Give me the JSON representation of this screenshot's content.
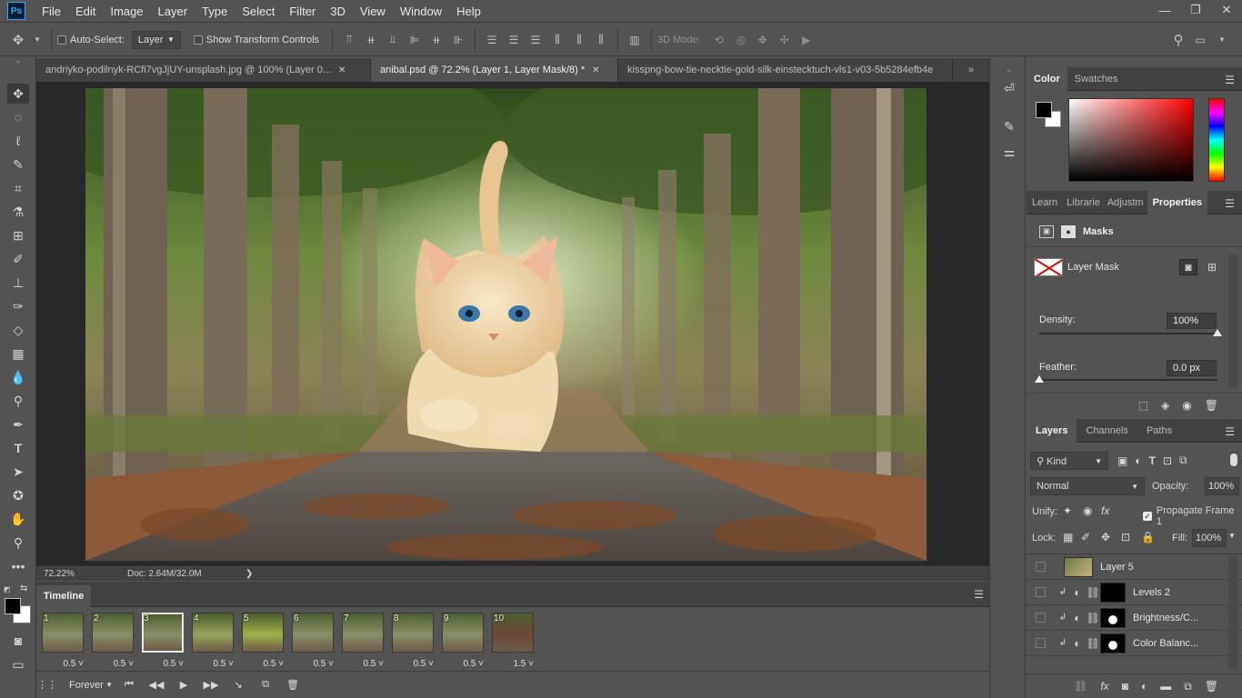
{
  "app": {
    "logo": "Ps"
  },
  "menu": [
    "File",
    "Edit",
    "Image",
    "Layer",
    "Type",
    "Select",
    "Filter",
    "3D",
    "View",
    "Window",
    "Help"
  ],
  "window_controls": {
    "minimize": "—",
    "restore": "❐",
    "close": "✕"
  },
  "options": {
    "auto_select_label": "Auto-Select:",
    "auto_select_target": "Layer",
    "show_transform_label": "Show Transform Controls",
    "mode_3d_label": "3D Mode:"
  },
  "tabs": [
    {
      "label": "andriyko-podilnyk-RCfi7vgJjUY-unsplash.jpg @ 100% (Layer 0...",
      "active": false
    },
    {
      "label": "anibal.psd @ 72.2% (Layer 1, Layer Mask/8) *",
      "active": true
    },
    {
      "label": "kisspng-bow-tie-necktie-gold-silk-einstecktuch-vls1-v03-5b5284efb4e",
      "active": false
    }
  ],
  "status": {
    "zoom": "72.22%",
    "doc": "Doc: 2.64M/32.0M",
    "arrow": "❯"
  },
  "timeline": {
    "tab_label": "Timeline",
    "frames": [
      {
        "num": "1",
        "delay": "0.5"
      },
      {
        "num": "2",
        "delay": "0.5"
      },
      {
        "num": "3",
        "delay": "0.5"
      },
      {
        "num": "4",
        "delay": "0.5"
      },
      {
        "num": "5",
        "delay": "0.5"
      },
      {
        "num": "6",
        "delay": "0.5"
      },
      {
        "num": "7",
        "delay": "0.5"
      },
      {
        "num": "8",
        "delay": "0.5"
      },
      {
        "num": "9",
        "delay": "0.5"
      },
      {
        "num": "10",
        "delay": "1.5"
      }
    ],
    "active_frame": 2,
    "loop": "Forever"
  },
  "color_panel": {
    "tabs": [
      "Color",
      "Swatches"
    ],
    "foreground": "#000000",
    "background": "#ffffff",
    "hue": "#ff0000"
  },
  "properties_panel": {
    "tabs": [
      "Learn",
      "Librarie",
      "Adjustm",
      "Properties"
    ],
    "section": "Masks",
    "mask_label": "Layer Mask",
    "density_label": "Density:",
    "density_value": "100%",
    "density": 1.0,
    "feather_label": "Feather:",
    "feather_value": "0.0 px",
    "feather": 0.0
  },
  "layers_panel": {
    "tabs": [
      "Layers",
      "Channels",
      "Paths"
    ],
    "filter_kind": "Kind",
    "blend_mode": "Normal",
    "opacity_label": "Opacity:",
    "opacity_value": "100%",
    "unify_label": "Unify:",
    "propagate_label": "Propagate Frame 1",
    "lock_label": "Lock:",
    "fill_label": "Fill:",
    "fill_value": "100%",
    "layers": [
      {
        "name": "Layer 5"
      },
      {
        "name": "Levels 2"
      },
      {
        "name": "Brightness/C..."
      },
      {
        "name": "Color Balanc..."
      }
    ]
  }
}
